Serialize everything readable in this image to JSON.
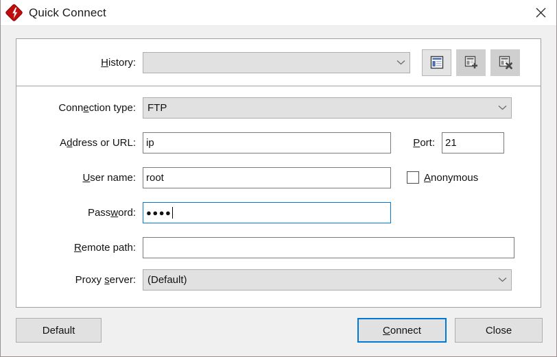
{
  "window": {
    "title": "Quick Connect",
    "icon": "filezilla-lightning-icon",
    "close_icon": "close-icon",
    "accent_color": "#0078d7",
    "brand_color": "#bf0d0d"
  },
  "form": {
    "history": {
      "label_pre": "",
      "label_mnemonic": "H",
      "label_post": "istory:",
      "value": "",
      "dropdown_icon": "chevron-down-icon"
    },
    "history_buttons": [
      {
        "name": "site-manager-button",
        "icon": "site-manager-icon",
        "active": true
      },
      {
        "name": "add-history-entry-button",
        "icon": "document-add-icon",
        "active": false
      },
      {
        "name": "clear-history-button",
        "icon": "document-remove-icon",
        "active": false
      }
    ],
    "connection_type": {
      "label_pre": "Conn",
      "label_mnemonic": "e",
      "label_post": "ction type:",
      "value": "FTP",
      "dropdown_icon": "chevron-down-icon"
    },
    "address": {
      "label_pre": "A",
      "label_mnemonic": "d",
      "label_post": "dress or URL:",
      "value": "ip"
    },
    "port": {
      "label_pre": "",
      "label_mnemonic": "P",
      "label_post": "ort:",
      "value": "21"
    },
    "username": {
      "label_pre": "",
      "label_mnemonic": "U",
      "label_post": "ser name:",
      "value": "root"
    },
    "anonymous": {
      "label_pre": "",
      "label_mnemonic": "A",
      "label_post": "nonymous",
      "checked": false
    },
    "password": {
      "label_pre": "Pass",
      "label_mnemonic": "w",
      "label_post": "ord:",
      "value": "●●●●",
      "focused": true
    },
    "remote_path": {
      "label_pre": "",
      "label_mnemonic": "R",
      "label_post": "emote path:",
      "value": ""
    },
    "proxy_server": {
      "label_pre": "Proxy ",
      "label_mnemonic": "s",
      "label_post": "erver:",
      "value": "(Default)",
      "dropdown_icon": "chevron-down-icon"
    }
  },
  "footer": {
    "default_button": "Default",
    "connect_button_pre": "",
    "connect_button_mnemonic": "C",
    "connect_button_post": "onnect",
    "close_button": "Close"
  }
}
